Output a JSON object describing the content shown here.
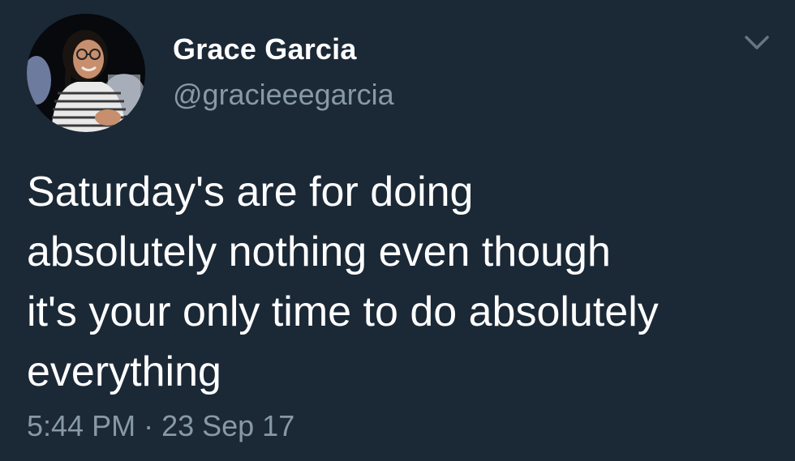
{
  "user": {
    "display_name": "Grace Garcia",
    "handle": "@gracieeegarcia"
  },
  "tweet": {
    "text": "Saturday's are for doing\nabsolutely nothing even though\nit's your only time to do absolutely\neverything",
    "time": "5:44 PM",
    "separator": "·",
    "date": "23 Sep 17"
  },
  "icons": {
    "avatar": "avatar",
    "menu": "chevron-down-icon"
  },
  "colors": {
    "background": "#1b2836",
    "primary_text": "#ffffff",
    "secondary_text": "#8899a6"
  }
}
